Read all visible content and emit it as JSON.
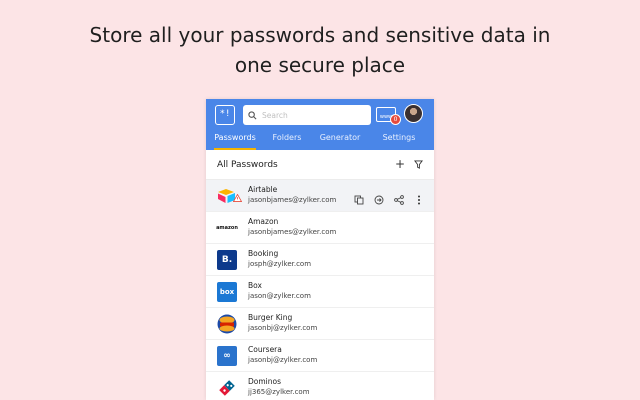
{
  "headline": {
    "line1": "Store all your passwords and sensitive data in",
    "line2": "one secure place"
  },
  "topbar": {
    "logo_text": "*!",
    "search_placeholder": "Search",
    "www_label": "www",
    "notification_count": "0"
  },
  "tabs": [
    {
      "label": "Passwords",
      "active": true
    },
    {
      "label": "Folders",
      "active": false
    },
    {
      "label": "Generator",
      "active": false
    },
    {
      "label": "Settings",
      "active": false
    }
  ],
  "list": {
    "title": "All Passwords",
    "add_label": "+",
    "items": [
      {
        "name": "Airtable",
        "email": "jasonbjames@zylker.com",
        "icon": "airtable-logo",
        "warning": true
      },
      {
        "name": "Amazon",
        "email": "jasonbjames@zylker.com",
        "icon": "amazon-logo",
        "icon_text": "amazon"
      },
      {
        "name": "Booking",
        "email": "josph@zylker.com",
        "icon": "booking-logo",
        "icon_text": "B."
      },
      {
        "name": "Box",
        "email": "jason@zylker.com",
        "icon": "box-logo",
        "icon_text": "box"
      },
      {
        "name": "Burger King",
        "email": "jasonbj@zylker.com",
        "icon": "burger-king-logo"
      },
      {
        "name": "Coursera",
        "email": "jasonbj@zylker.com",
        "icon": "coursera-logo",
        "icon_text": "∞"
      },
      {
        "name": "Dominos",
        "email": "jj365@zylker.com",
        "icon": "dominos-logo"
      }
    ]
  },
  "colors": {
    "page_background": "#fce4e6",
    "header_blue": "#4a86e8",
    "tab_indicator": "#f4b400",
    "badge_red": "#e64a3b"
  }
}
